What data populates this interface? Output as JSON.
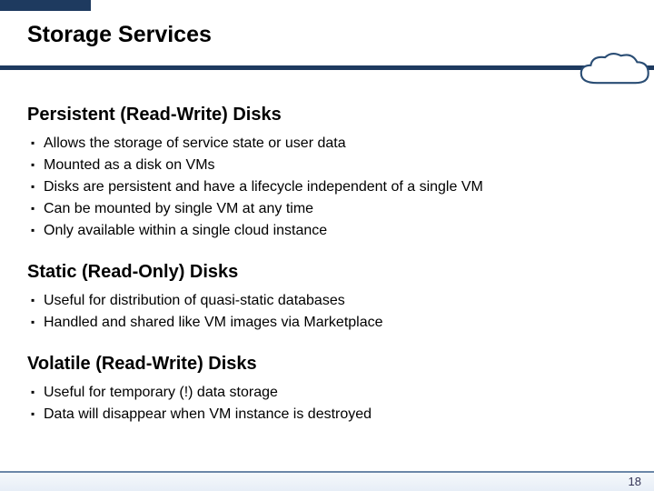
{
  "title": "Storage Services",
  "sections": [
    {
      "heading": "Persistent (Read-Write) Disks",
      "items": [
        "Allows the storage of service state or user data",
        "Mounted as a disk on VMs",
        "Disks are persistent and have a lifecycle independent of a single VM",
        "Can be mounted by single VM at any time",
        "Only available within a single cloud instance"
      ]
    },
    {
      "heading": "Static (Read-Only) Disks",
      "items": [
        "Useful for distribution of quasi-static databases",
        "Handled and shared like VM images via Marketplace"
      ]
    },
    {
      "heading": "Volatile (Read-Write) Disks",
      "items": [
        "Useful for temporary (!) data storage",
        "Data will disappear when VM instance is destroyed"
      ]
    }
  ],
  "page_number": "18"
}
